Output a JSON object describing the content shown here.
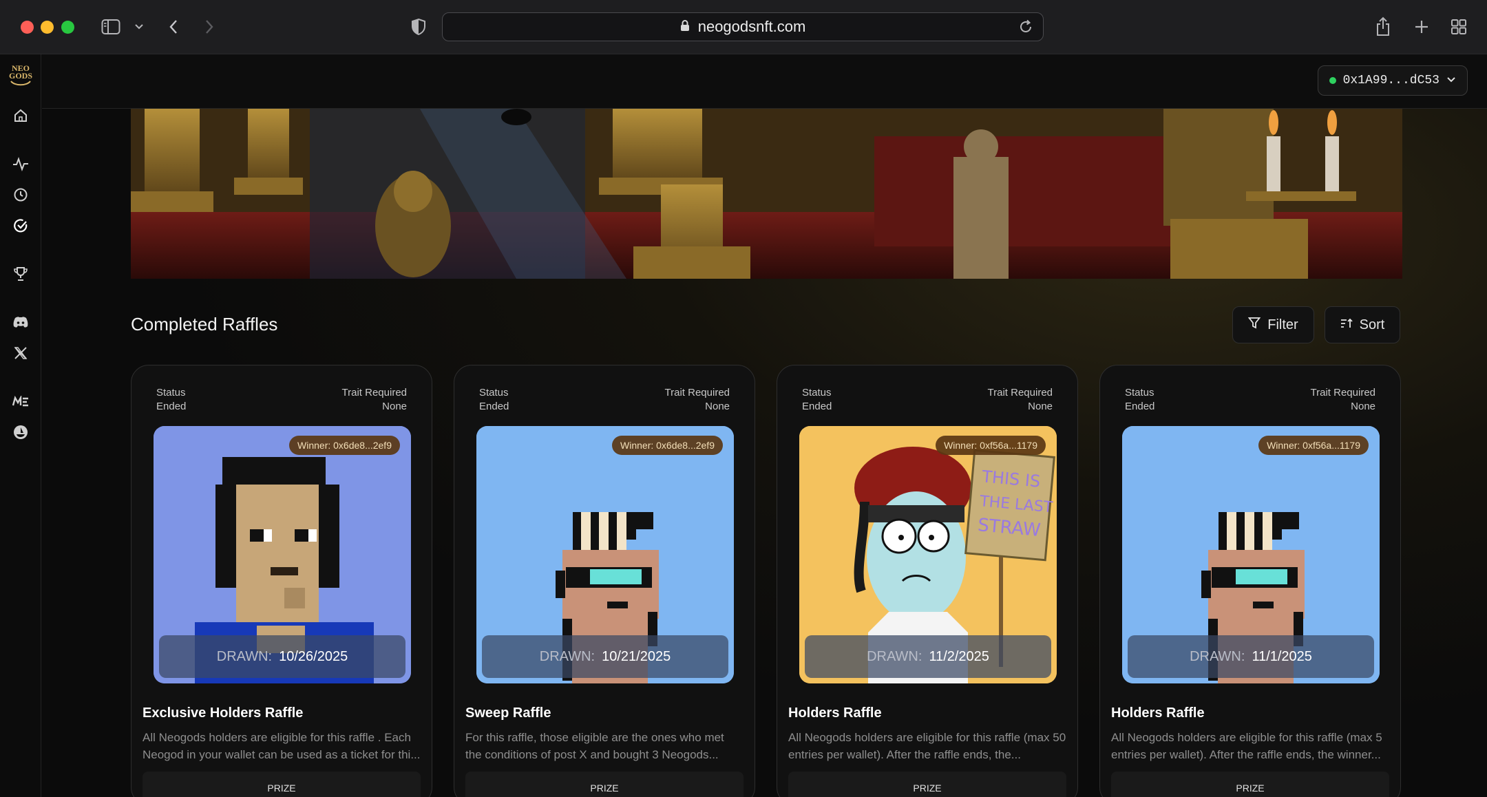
{
  "browser": {
    "url": "neogodsnft.com",
    "icons": [
      "sidebar-icon",
      "chevron-down-icon",
      "back-icon",
      "forward-icon",
      "shield-icon",
      "lock-icon",
      "reload-icon",
      "share-icon",
      "plus-icon",
      "tabs-grid-icon"
    ]
  },
  "sidebar": {
    "logo_line1": "NEO",
    "logo_line2": "GODS",
    "items": [
      "home-icon",
      "activity-icon",
      "clock-icon",
      "check-circle-icon",
      "trophy-icon",
      "discord-icon",
      "x-icon",
      "magic-eden-icon",
      "opensea-icon"
    ]
  },
  "wallet": {
    "address": "0x1A99...dC53",
    "status_color": "#2ed15f"
  },
  "section": {
    "title": "Completed Raffles",
    "filter_label": "Filter",
    "sort_label": "Sort"
  },
  "cards": [
    {
      "status_label": "Status",
      "status": "Ended",
      "trait_label": "Trait Required",
      "trait": "None",
      "winner": "Winner: 0x6de8...2ef9",
      "drawn_label": "DRAWN:",
      "drawn_date": "10/26/2025",
      "title": "Exclusive Holders Raffle",
      "description": "All Neogods holders are eligible for this raffle . Each Neogod in your wallet can be used as a ticket for thi...",
      "prize_label": "PRIZE",
      "bg_color": "#7f95e6"
    },
    {
      "status_label": "Status",
      "status": "Ended",
      "trait_label": "Trait Required",
      "trait": "None",
      "winner": "Winner: 0x6de8...2ef9",
      "drawn_label": "DRAWN:",
      "drawn_date": "10/21/2025",
      "title": "Sweep Raffle",
      "description": "For this raffle, those eligible are the ones who met the conditions of post X and bought 3 Neogods...",
      "prize_label": "PRIZE",
      "bg_color": "#7fb6f2"
    },
    {
      "status_label": "Status",
      "status": "Ended",
      "trait_label": "Trait Required",
      "trait": "None",
      "winner": "Winner: 0xf56a...1179",
      "drawn_label": "DRAWN:",
      "drawn_date": "11/2/2025",
      "title": "Holders Raffle",
      "description": "All Neogods holders are eligible for this raffle (max 50 entries per wallet). After the raffle ends, the...",
      "prize_label": "PRIZE",
      "bg_color": "#f4c25e",
      "sign_text": "THIS IS THE LAST STRAW"
    },
    {
      "status_label": "Status",
      "status": "Ended",
      "trait_label": "Trait Required",
      "trait": "None",
      "winner": "Winner: 0xf56a...1179",
      "drawn_label": "DRAWN:",
      "drawn_date": "11/1/2025",
      "title": "Holders Raffle",
      "description": "All Neogods holders are eligible for this raffle (max 5 entries per wallet). After the raffle ends, the winner...",
      "prize_label": "PRIZE",
      "bg_color": "#7fb6f2"
    }
  ]
}
